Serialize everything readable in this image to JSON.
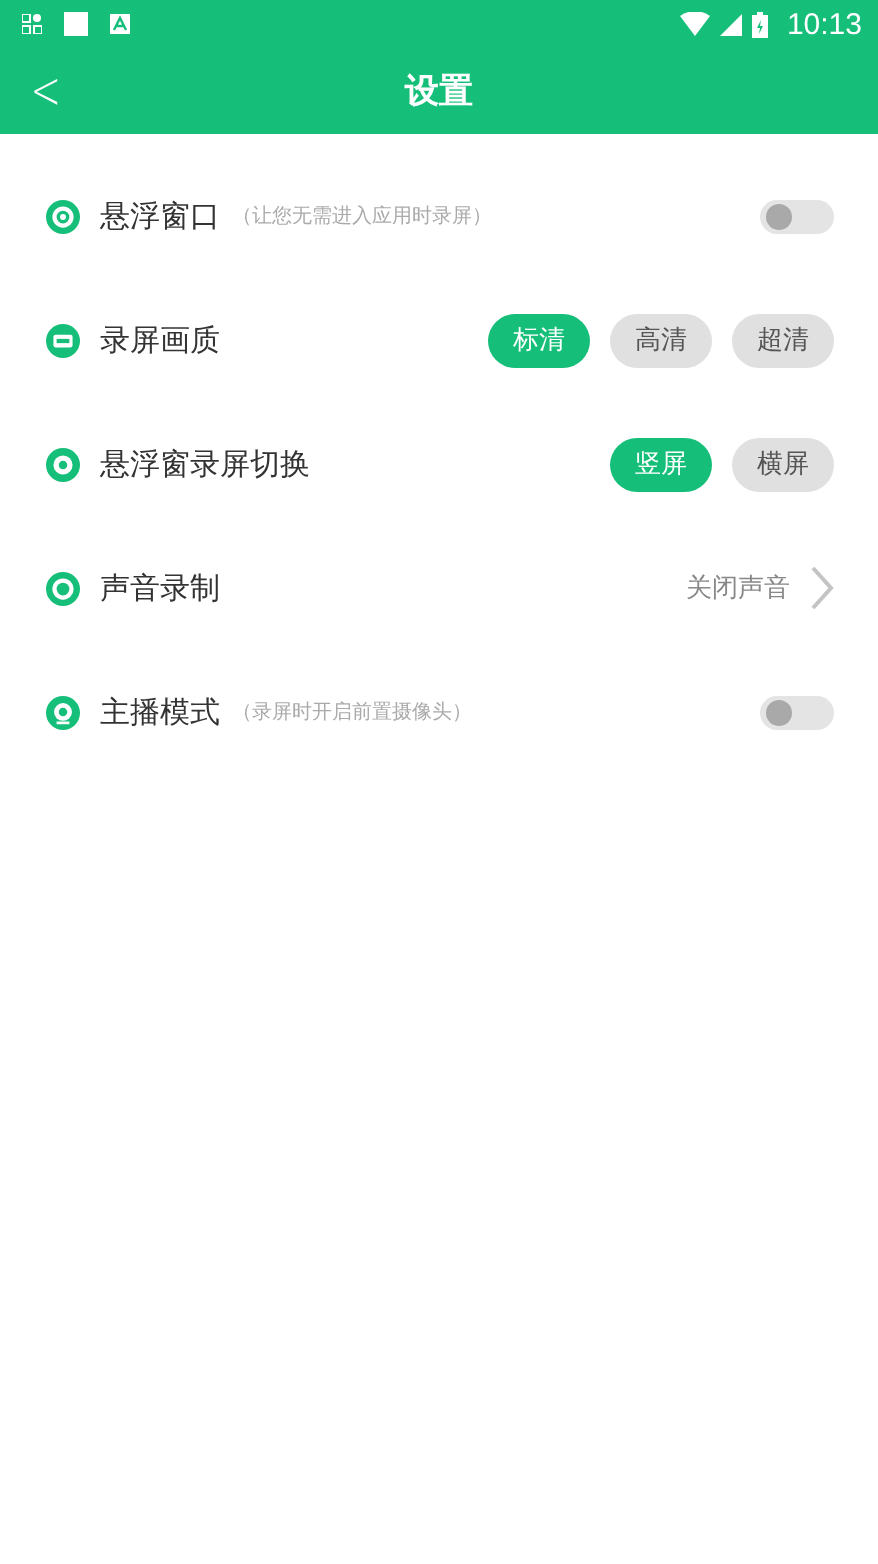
{
  "status_bar": {
    "time": "10:13"
  },
  "header": {
    "back": "<",
    "title": "设置"
  },
  "settings": [
    {
      "kind": "toggle",
      "label": "悬浮窗口",
      "hint": "（让您无需进入应用时录屏）",
      "on": false
    },
    {
      "kind": "options",
      "label": "录屏画质",
      "options": [
        {
          "label": "标清",
          "selected": true
        },
        {
          "label": "高清",
          "selected": false
        },
        {
          "label": "超清",
          "selected": false
        }
      ]
    },
    {
      "kind": "options",
      "label": "悬浮窗录屏切换",
      "options": [
        {
          "label": "竖屏",
          "selected": true
        },
        {
          "label": "横屏",
          "selected": false
        }
      ]
    },
    {
      "kind": "link",
      "label": "声音录制",
      "value": "关闭声音"
    },
    {
      "kind": "toggle",
      "label": "主播模式",
      "hint": "（录屏时开启前置摄像头）",
      "on": false
    }
  ]
}
